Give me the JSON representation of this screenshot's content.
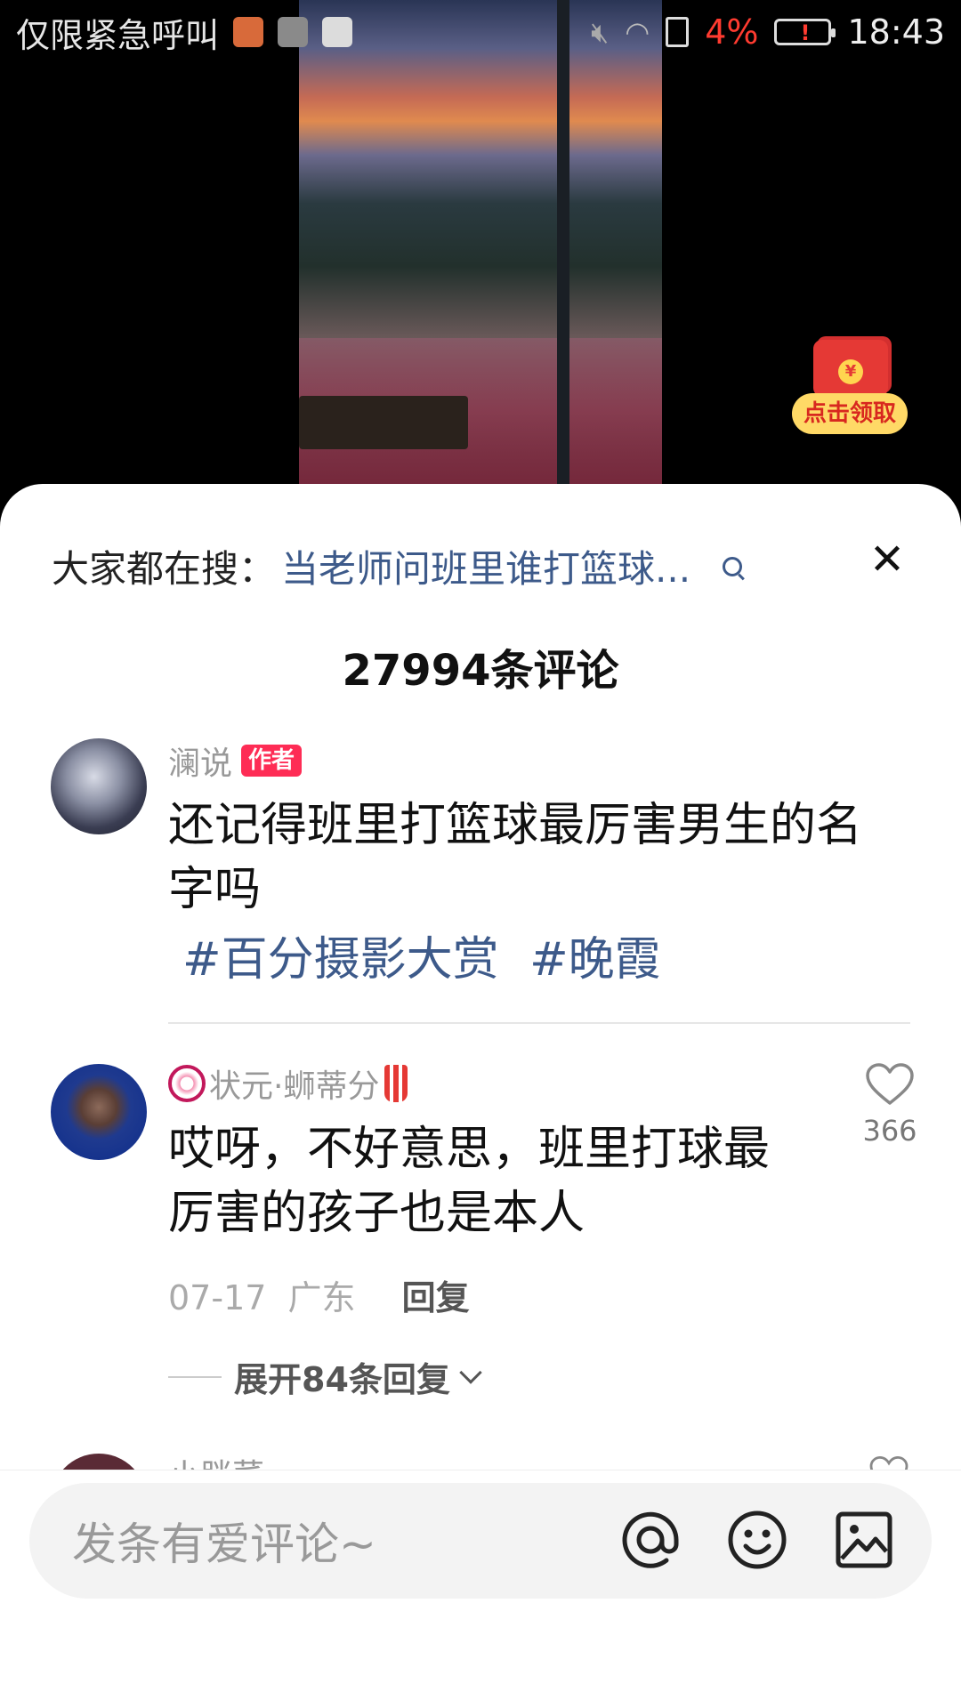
{
  "status_bar": {
    "carrier": "仅限紧急呼叫",
    "battery_percent": "4%",
    "time": "18:43"
  },
  "red_packet": {
    "label": "点击领取",
    "symbol": "¥"
  },
  "search_banner": {
    "prefix": "大家都在搜：",
    "query": "当老师问班里谁打篮球..."
  },
  "comments_header": {
    "title": "27994条评论"
  },
  "post": {
    "author": "澜说",
    "author_tag": "作者",
    "text": "还记得班里打篮球最厉害男生的名字吗",
    "hashtags": [
      "#百分摄影大赏",
      "#晚霞"
    ]
  },
  "comment": {
    "username": "状元·蛳蒂分",
    "text": "哎呀，不好意思，班里打球最厉害的孩子也是本人",
    "date": "07-17",
    "location": "广东",
    "reply_label": "回复",
    "likes": "366",
    "expand_label": "展开84条回复"
  },
  "next_comment": {
    "username_partial": "小胖菜"
  },
  "input": {
    "placeholder": "发条有爱评论~"
  },
  "colors": {
    "accent_link": "#3d5a8a",
    "author_tag": "#fe2c55",
    "battery_low": "#ff3b30"
  }
}
